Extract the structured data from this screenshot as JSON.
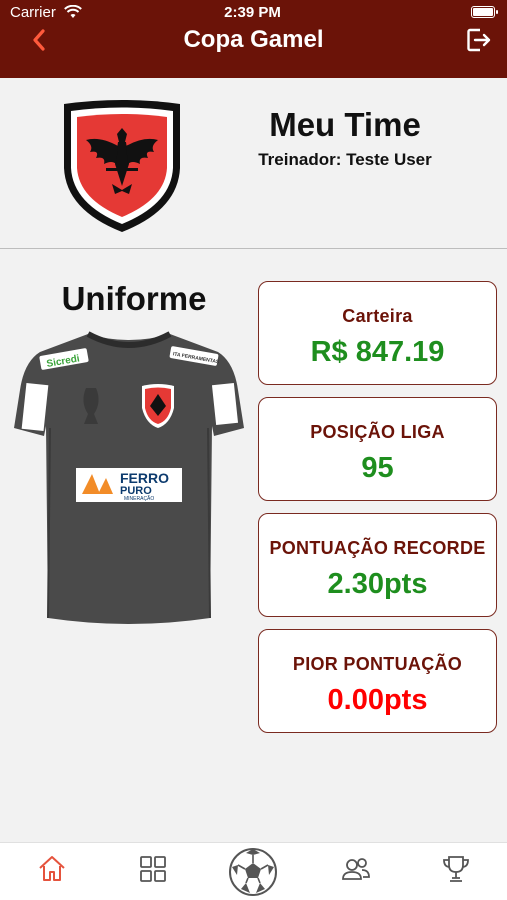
{
  "status_bar": {
    "carrier": "Carrier",
    "time": "2:39 PM"
  },
  "nav": {
    "title": "Copa Gamel",
    "back_icon": "chevron-left-icon",
    "exit_icon": "logout-icon"
  },
  "team": {
    "name": "Meu Time",
    "coach": "Treinador: Teste User",
    "crest_icon": "eagle-crest-icon"
  },
  "uniform": {
    "title": "Uniforme",
    "sponsors": {
      "chest_line1": "FERRO",
      "chest_line2": "PURO",
      "chest_line3": "MINERAÇÃO",
      "left": "Sicredi",
      "right": "ITA FERRAMENTAS"
    }
  },
  "stats": [
    {
      "label": "Carteira",
      "value": "R$ 847.19",
      "color": "#1e8e1e"
    },
    {
      "label": "POSIÇÃO LIGA",
      "value": "95",
      "color": "#1e8e1e"
    },
    {
      "label": "PONTUAÇÃO RECORDE",
      "value": "2.30pts",
      "color": "#1e8e1e"
    },
    {
      "label": "PIOR PONTUAÇÃO",
      "value": "0.00pts",
      "color": "#ff0000"
    }
  ],
  "tabs": [
    {
      "icon": "home-icon",
      "active": true
    },
    {
      "icon": "grid-icon",
      "active": false
    },
    {
      "icon": "soccer-ball-icon",
      "active": false
    },
    {
      "icon": "users-icon",
      "active": false
    },
    {
      "icon": "trophy-icon",
      "active": false
    }
  ],
  "colors": {
    "primary": "#6b1308",
    "positive": "#1e8e1e",
    "negative": "#ff0000",
    "active_tab": "#e5533d"
  }
}
